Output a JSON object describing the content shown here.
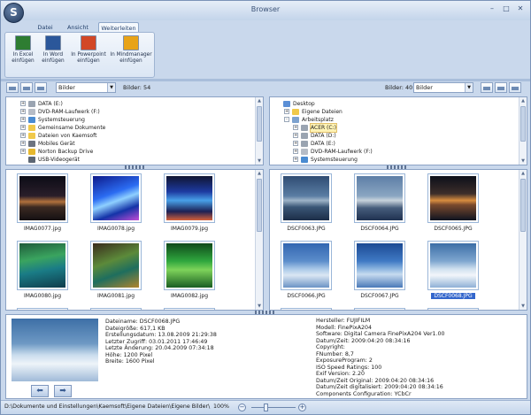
{
  "window": {
    "title": "Browser",
    "orb_glyph": "S"
  },
  "tabs": [
    {
      "label": "Datei",
      "active": false
    },
    {
      "label": "Ansicht",
      "active": false
    },
    {
      "label": "Weiterleiten",
      "active": true
    }
  ],
  "ribbon": [
    {
      "line1": "In Excel",
      "line2": "einfügen",
      "icon": "excel-icon",
      "color": "#2e7d32"
    },
    {
      "line1": "In Word",
      "line2": "einfügen",
      "icon": "word-icon",
      "color": "#2b579a"
    },
    {
      "line1": "In Powerpoint",
      "line2": "einfügen",
      "icon": "powerpoint-icon",
      "color": "#d24726"
    },
    {
      "line1": "In Mindmanager",
      "line2": "einfügen",
      "icon": "mindmanager-icon",
      "color": "#e8a317"
    }
  ],
  "left_panel": {
    "folder": "Bilder",
    "count_label": "Bilder: 54",
    "tree": [
      {
        "label": "DATA (E:)",
        "icon": "drive-icon",
        "expander": "+",
        "indent": 1
      },
      {
        "label": "DVD-RAM-Laufwerk (F:)",
        "icon": "dvd-drive-icon",
        "expander": "+",
        "indent": 1
      },
      {
        "label": "Systemsteuerung",
        "icon": "control-panel-icon",
        "expander": "+",
        "indent": 1
      },
      {
        "label": "Gemeinsame Dokumente",
        "icon": "folder-icon",
        "expander": "+",
        "indent": 1
      },
      {
        "label": "Dateien von Kaemsoft",
        "icon": "folder-icon",
        "expander": "+",
        "indent": 1
      },
      {
        "label": "Mobiles Gerät",
        "icon": "phone-icon",
        "expander": "+",
        "indent": 1
      },
      {
        "label": "Norton Backup Drive",
        "icon": "backup-drive-icon",
        "expander": "+",
        "indent": 1
      },
      {
        "label": "USB-Videogerät",
        "icon": "camera-icon",
        "expander": "",
        "indent": 1
      }
    ],
    "thumbs": [
      {
        "name": "IMAG0077.jpg",
        "art": "city-night"
      },
      {
        "name": "IMAG0078.jpg",
        "art": "blue-neon"
      },
      {
        "name": "IMAG0079.jpg",
        "art": "mall"
      },
      {
        "name": "IMAG0080.jpg",
        "art": "aquarium"
      },
      {
        "name": "IMAG0081.jpg",
        "art": "aquarium2"
      },
      {
        "name": "IMAG0082.jpg",
        "art": "green"
      }
    ]
  },
  "right_panel": {
    "folder": "Bilder",
    "count_label": "Bilder: 40",
    "tree": [
      {
        "label": "Desktop",
        "icon": "desktop-icon",
        "expander": "",
        "indent": 0
      },
      {
        "label": "Eigene Dateien",
        "icon": "folder-icon",
        "expander": "+",
        "indent": 1
      },
      {
        "label": "Arbeitsplatz",
        "icon": "computer-icon",
        "expander": "-",
        "indent": 1
      },
      {
        "label": "ACER (C:)",
        "icon": "drive-icon",
        "expander": "+",
        "indent": 2,
        "selected": true
      },
      {
        "label": "DATA (D:)",
        "icon": "drive-icon",
        "expander": "+",
        "indent": 2
      },
      {
        "label": "DATA (E:)",
        "icon": "drive-icon",
        "expander": "+",
        "indent": 2
      },
      {
        "label": "DVD-RAM-Laufwerk (F:)",
        "icon": "dvd-drive-icon",
        "expander": "+",
        "indent": 2
      },
      {
        "label": "Systemsteuerung",
        "icon": "control-panel-icon",
        "expander": "+",
        "indent": 2
      }
    ],
    "thumbs": [
      {
        "name": "DSCF0063.JPG",
        "art": "sky-dusk"
      },
      {
        "name": "DSCF0064.JPG",
        "art": "sky-dusk2"
      },
      {
        "name": "DSCF0065.JPG",
        "art": "sky-wing"
      },
      {
        "name": "DSCF0066.JPG",
        "art": "sky-blue"
      },
      {
        "name": "DSCF0067.JPG",
        "art": "sky-blue2"
      },
      {
        "name": "DSCF0068.JPG",
        "art": "sky-clouds",
        "selected": true
      }
    ]
  },
  "details_left": [
    "Dateiname: DSCF0068.JPG",
    "Dateigröße: 617,1 KB",
    "Erstellungsdatum: 13.08.2009 21:29:38",
    "Letzter Zugriff: 03.01.2011 17:46:49",
    "Letzte Änderung: 20.04.2009 07:34:18",
    "Höhe: 1200 Pixel",
    "Breite: 1600 Pixel"
  ],
  "details_right": [
    "Hersteller: FUJIFILM",
    "Modell: FinePixA204",
    "Software: Digital Camera FinePixA204   Ver1.00",
    "Datum/Zeit: 2009:04:20 08:34:16",
    "Copyright:",
    "FNumber: 8,7",
    "ExposureProgram: 2",
    "ISO Speed Ratings: 100",
    "Exif Version: 2.20",
    "Datum/Zeit Original: 2009:04:20 08:34:16",
    "Datum/Zeit digitalisiert: 2009:04:20 08:34:16",
    "Components Configuration: YCbCr"
  ],
  "status": {
    "path": "D:\\Dokumente und Einstellungen\\Kaemsoft\\Eigene Dateien\\Eigene Bilder\\",
    "zoom": "100%",
    "zoom_level": 0.3
  }
}
